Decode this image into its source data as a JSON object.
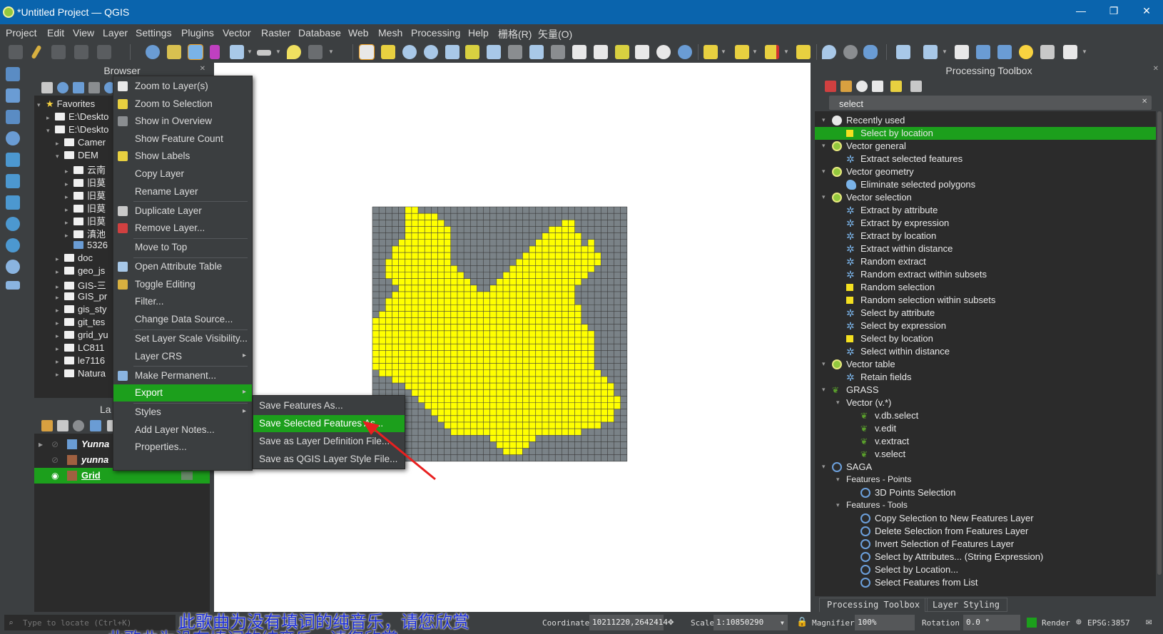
{
  "window": {
    "title": "*Untitled Project — QGIS",
    "minimize": "—",
    "restore": "❐",
    "close": "✕"
  },
  "menubar": [
    "Project",
    "Edit",
    "View",
    "Layer",
    "Settings",
    "Plugins",
    "Vector",
    "Raster",
    "Database",
    "Web",
    "Mesh",
    "Processing",
    "Help",
    "栅格(R)",
    "矢量(O)"
  ],
  "browser": {
    "title": "Browser",
    "items": [
      {
        "label": "Favorites",
        "indent": 0,
        "arrow": "▾",
        "icon": "star"
      },
      {
        "label": "E:\\Deskto",
        "indent": 1,
        "arrow": "▸",
        "icon": "folder"
      },
      {
        "label": "E:\\Deskto",
        "indent": 1,
        "arrow": "▾",
        "icon": "folder"
      },
      {
        "label": "Camer",
        "indent": 2,
        "arrow": "▸",
        "icon": "folder"
      },
      {
        "label": "DEM",
        "indent": 2,
        "arrow": "▾",
        "icon": "folder"
      },
      {
        "label": "云南",
        "indent": 3,
        "arrow": "▸",
        "icon": "folder"
      },
      {
        "label": "旧莫",
        "indent": 3,
        "arrow": "▸",
        "icon": "folder"
      },
      {
        "label": "旧莫",
        "indent": 3,
        "arrow": "▸",
        "icon": "folder"
      },
      {
        "label": "旧莫",
        "indent": 3,
        "arrow": "▸",
        "icon": "folder"
      },
      {
        "label": "旧莫",
        "indent": 3,
        "arrow": "▸",
        "icon": "folder"
      },
      {
        "label": "滇池",
        "indent": 3,
        "arrow": "▸",
        "icon": "folder"
      },
      {
        "label": "5326",
        "indent": 3,
        "arrow": "",
        "icon": "grid"
      },
      {
        "label": "doc",
        "indent": 2,
        "arrow": "▸",
        "icon": "folder"
      },
      {
        "label": "geo_js",
        "indent": 2,
        "arrow": "▸",
        "icon": "folder"
      },
      {
        "label": "GIS-三",
        "indent": 2,
        "arrow": "▸",
        "icon": "folder"
      },
      {
        "label": "GIS_pr",
        "indent": 2,
        "arrow": "▸",
        "icon": "folder"
      },
      {
        "label": "gis_sty",
        "indent": 2,
        "arrow": "▸",
        "icon": "folder"
      },
      {
        "label": "git_tes",
        "indent": 2,
        "arrow": "▸",
        "icon": "folder"
      },
      {
        "label": "grid_yu",
        "indent": 2,
        "arrow": "▸",
        "icon": "folder"
      },
      {
        "label": "LC811",
        "indent": 2,
        "arrow": "▸",
        "icon": "folder"
      },
      {
        "label": "le7116",
        "indent": 2,
        "arrow": "▸",
        "icon": "folder"
      },
      {
        "label": "Natura",
        "indent": 2,
        "arrow": "▸",
        "icon": "folder"
      }
    ]
  },
  "layers": {
    "title": "La",
    "items": [
      {
        "label": "Yunna",
        "symbol": "grid-icon",
        "selected": false
      },
      {
        "label": "yunna",
        "symbol": "brown",
        "selected": false
      },
      {
        "label": "Grid",
        "symbol": "brown",
        "selected": true
      }
    ]
  },
  "context_menu": [
    {
      "label": "Zoom to Layer(s)",
      "icon": "zoom-layer-icon",
      "sep_after": false
    },
    {
      "label": "Zoom to Selection",
      "icon": "zoom-selection-icon",
      "sep_after": false
    },
    {
      "label": "Show in Overview",
      "icon": "overview-icon",
      "sep_after": false
    },
    {
      "label": "Show Feature Count",
      "icon": "",
      "sep_after": false
    },
    {
      "label": "Show Labels",
      "icon": "labels-icon",
      "sep_after": false
    },
    {
      "label": "Copy Layer",
      "icon": "",
      "sep_after": false
    },
    {
      "label": "Rename Layer",
      "icon": "",
      "sep_after": true
    },
    {
      "label": "Duplicate Layer",
      "icon": "duplicate-icon",
      "sep_after": false
    },
    {
      "label": "Remove Layer...",
      "icon": "remove-icon",
      "sep_after": true
    },
    {
      "label": "Move to Top",
      "icon": "",
      "sep_after": true
    },
    {
      "label": "Open Attribute Table",
      "icon": "table-icon",
      "sep_after": false
    },
    {
      "label": "Toggle Editing",
      "icon": "pencil-icon",
      "sep_after": false
    },
    {
      "label": "Filter...",
      "icon": "",
      "sep_after": false
    },
    {
      "label": "Change Data Source...",
      "icon": "",
      "sep_after": true
    },
    {
      "label": "Set Layer Scale Visibility...",
      "icon": "",
      "sep_after": false
    },
    {
      "label": "Layer CRS",
      "icon": "",
      "sep_after": true,
      "submenu": true
    },
    {
      "label": "Make Permanent...",
      "icon": "save-icon",
      "sep_after": false
    },
    {
      "label": "Export",
      "icon": "",
      "sep_after": true,
      "submenu": true,
      "highlight": true
    },
    {
      "label": "Styles",
      "icon": "",
      "sep_after": false,
      "submenu": true
    },
    {
      "label": "Add Layer Notes...",
      "icon": "",
      "sep_after": false
    },
    {
      "label": "Properties...",
      "icon": "",
      "sep_after": false
    }
  ],
  "export_submenu": [
    {
      "label": "Save Features As...",
      "highlight": false
    },
    {
      "label": "Save Selected Features As...",
      "highlight": true
    },
    {
      "label": "Save as Layer Definition File...",
      "highlight": false
    },
    {
      "label": "Save as QGIS Layer Style File...",
      "highlight": false
    }
  ],
  "processing": {
    "title": "Processing Toolbox",
    "search_value": "select",
    "tree": [
      {
        "label": "Recently used",
        "level": 0,
        "icon": "clock",
        "arrow": "▾"
      },
      {
        "label": "Select by location",
        "level": 1,
        "icon": "yellow",
        "selected": true
      },
      {
        "label": "Vector general",
        "level": 0,
        "icon": "qgis",
        "arrow": "▾"
      },
      {
        "label": "Extract selected features",
        "level": 1,
        "icon": "gear"
      },
      {
        "label": "Vector geometry",
        "level": 0,
        "icon": "qgis",
        "arrow": "▾"
      },
      {
        "label": "Eliminate selected polygons",
        "level": 1,
        "icon": "blueshape"
      },
      {
        "label": "Vector selection",
        "level": 0,
        "icon": "qgis",
        "arrow": "▾"
      },
      {
        "label": "Extract by attribute",
        "level": 1,
        "icon": "gear"
      },
      {
        "label": "Extract by expression",
        "level": 1,
        "icon": "gear"
      },
      {
        "label": "Extract by location",
        "level": 1,
        "icon": "gear"
      },
      {
        "label": "Extract within distance",
        "level": 1,
        "icon": "gear"
      },
      {
        "label": "Random extract",
        "level": 1,
        "icon": "gear"
      },
      {
        "label": "Random extract within subsets",
        "level": 1,
        "icon": "gear"
      },
      {
        "label": "Random selection",
        "level": 1,
        "icon": "yellow"
      },
      {
        "label": "Random selection within subsets",
        "level": 1,
        "icon": "yellow"
      },
      {
        "label": "Select by attribute",
        "level": 1,
        "icon": "gear"
      },
      {
        "label": "Select by expression",
        "level": 1,
        "icon": "gear"
      },
      {
        "label": "Select by location",
        "level": 1,
        "icon": "yellow"
      },
      {
        "label": "Select within distance",
        "level": 1,
        "icon": "gear"
      },
      {
        "label": "Vector table",
        "level": 0,
        "icon": "qgis",
        "arrow": "▾"
      },
      {
        "label": "Retain fields",
        "level": 1,
        "icon": "gear"
      },
      {
        "label": "GRASS",
        "level": 0,
        "icon": "grass",
        "arrow": "▾"
      },
      {
        "label": "Vector (v.*)",
        "level": 1,
        "icon": "",
        "arrow": "▾"
      },
      {
        "label": "v.db.select",
        "level": 2,
        "icon": "grass"
      },
      {
        "label": "v.edit",
        "level": 2,
        "icon": "grass"
      },
      {
        "label": "v.extract",
        "level": 2,
        "icon": "grass"
      },
      {
        "label": "v.select",
        "level": 2,
        "icon": "grass"
      },
      {
        "label": "SAGA",
        "level": 0,
        "icon": "saga",
        "arrow": "▾"
      },
      {
        "label": "Features - Points",
        "level": 1,
        "icon": "",
        "arrow": "▾",
        "small": true
      },
      {
        "label": "3D Points Selection",
        "level": 2,
        "icon": "saga"
      },
      {
        "label": "Features - Tools",
        "level": 1,
        "icon": "",
        "arrow": "▾",
        "small": true
      },
      {
        "label": "Copy Selection to New Features Layer",
        "level": 2,
        "icon": "saga"
      },
      {
        "label": "Delete Selection from Features Layer",
        "level": 2,
        "icon": "saga"
      },
      {
        "label": "Invert Selection of Features Layer",
        "level": 2,
        "icon": "saga"
      },
      {
        "label": "Select by Attributes... (String Expression)",
        "level": 2,
        "icon": "saga"
      },
      {
        "label": "Select by Location...",
        "level": 2,
        "icon": "saga"
      },
      {
        "label": "Select Features from List",
        "level": 2,
        "icon": "saga"
      }
    ],
    "tabs": [
      "Processing Toolbox",
      "Layer Styling"
    ]
  },
  "statusbar": {
    "locate_placeholder": "Type to locate (Ctrl+K)",
    "coordinate_label": "Coordinate",
    "coordinate_value": "10211220,2642414",
    "scale_label": "Scale",
    "scale_value": "1:10850290",
    "magnifier_label": "Magnifier",
    "magnifier_value": "100%",
    "rotation_label": "Rotation",
    "rotation_value": "0.0 °",
    "render_label": "Render",
    "crs_label": "EPSG:3857"
  },
  "subtitles": {
    "line1": "此歌曲为没有填词的纯音乐，请您欣赏",
    "line2": "此歌曲为没有填词的纯音乐，请您欣赏"
  },
  "colors": {
    "accent_green": "#1c9f1c",
    "fill_yellow": "#ffff00",
    "fill_grey": "#7a8287",
    "titlebar": "#0a64ad"
  }
}
